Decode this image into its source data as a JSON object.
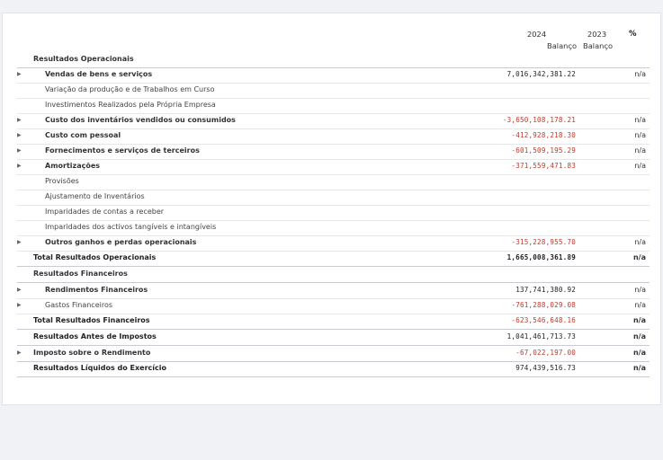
{
  "header": {
    "year1": "2024",
    "sub1": "Balanço",
    "year2": "2023",
    "sub2": "Balanço",
    "pct": "%"
  },
  "rows": [
    {
      "label": "Resultados Operacionais",
      "value": "",
      "pct": ""
    },
    {
      "label": "Vendas de bens e serviços",
      "value": "7,016,342,381.22",
      "pct": "n/a"
    },
    {
      "label": "Variação da produção e de Trabalhos em Curso",
      "value": "",
      "pct": ""
    },
    {
      "label": "Investimentos Realizados pela Própria Empresa",
      "value": "",
      "pct": ""
    },
    {
      "label": "Custo dos inventários vendidos ou consumidos",
      "value": "-3,650,108,178.21",
      "pct": "n/a"
    },
    {
      "label": "Custo com pessoal",
      "value": "-412,928,218.30",
      "pct": "n/a"
    },
    {
      "label": "Fornecimentos e serviços de terceiros",
      "value": "-601,509,195.29",
      "pct": "n/a"
    },
    {
      "label": "Amortizações",
      "value": "-371,559,471.83",
      "pct": "n/a"
    },
    {
      "label": "Provisões",
      "value": "",
      "pct": ""
    },
    {
      "label": "Ajustamento de Inventários",
      "value": "",
      "pct": ""
    },
    {
      "label": "Imparidades de contas a receber",
      "value": "",
      "pct": ""
    },
    {
      "label": "Imparidades dos activos tangíveis e intangíveis",
      "value": "",
      "pct": ""
    },
    {
      "label": "Outros ganhos e perdas operacionais",
      "value": "-315,228,955.70",
      "pct": "n/a"
    },
    {
      "label": "Total Resultados Operacionais",
      "value": "1,665,008,361.89",
      "pct": "n/a"
    },
    {
      "label": "Resultados Financeiros",
      "value": "",
      "pct": ""
    },
    {
      "label": "Rendimentos Financeiros",
      "value": "137,741,380.92",
      "pct": "n/a"
    },
    {
      "label": "Gastos Financeiros",
      "value": "-761,288,029.08",
      "pct": "n/a"
    },
    {
      "label": "Total Resultados Financeiros",
      "value": "-623,546,648.16",
      "pct": "n/a"
    },
    {
      "label": "Resultados Antes de Impostos",
      "value": "1,041,461,713.73",
      "pct": "n/a"
    },
    {
      "label": "Imposto sobre o Rendimento",
      "value": "-67,022,197.00",
      "pct": "n/a"
    },
    {
      "label": "Resultados Líquidos do Exercício",
      "value": "974,439,516.73",
      "pct": "n/a"
    }
  ],
  "colors": {
    "negative": "#c0392b",
    "background": "#f1f2f6"
  }
}
